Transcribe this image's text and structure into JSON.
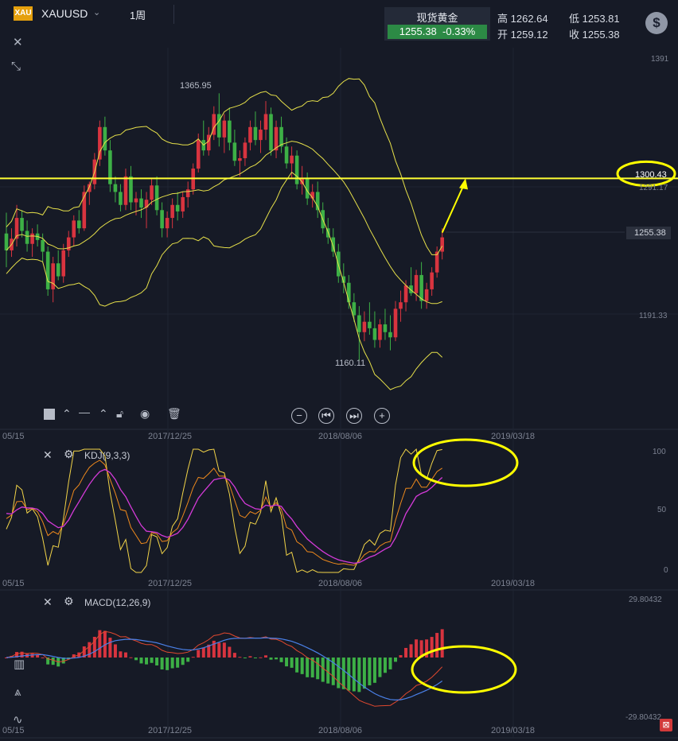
{
  "header": {
    "logo_text": "XAU",
    "symbol": "XAUUSD",
    "period": "1周",
    "quote_name": "现货黄金",
    "quote_price": "1255.38",
    "quote_change": "-0.33%",
    "high_label": "高",
    "high_value": "1262.64",
    "low_label": "低",
    "low_value": "1253.81",
    "open_label": "开",
    "open_value": "1259.12",
    "close_label": "收",
    "close_value": "1255.38",
    "currency_icon": "$"
  },
  "price_axis": {
    "top": "1391",
    "hline_label": "1300.43",
    "level_1291": "1291.17",
    "current": "1255.38",
    "level_1191": "1191.33"
  },
  "annotations": {
    "high_mark": "1365.95",
    "low_mark": "1160.11"
  },
  "dates": [
    "05/15",
    "2017/12/25",
    "2018/08/06",
    "2019/03/18"
  ],
  "kdj": {
    "label": "KDJ(9,3,3)",
    "axis_top": "100",
    "axis_mid": "50",
    "axis_bottom": "0"
  },
  "macd": {
    "label": "MACD(12,26,9)",
    "axis_top": "29.80432",
    "axis_bottom": "-29.80432"
  },
  "colors": {
    "background": "#161a26",
    "up": "#d8343f",
    "down": "#3db046",
    "bollinger": "#e6e04a",
    "hline": "#ffff33",
    "k_line": "#f2d448",
    "d_line": "#f08a1c",
    "j_line": "#d43ad8",
    "macd_fast": "#e0482f",
    "macd_slow": "#4a80e8",
    "highlight": "#ffff00"
  },
  "chart_data": {
    "type": "candlestick",
    "highlight_level": 1300.43,
    "y_range": [
      1150,
      1395
    ],
    "candles": [
      [
        1258,
        1274,
        1232,
        1245
      ],
      [
        1245,
        1262,
        1240,
        1254
      ],
      [
        1254,
        1280,
        1248,
        1270
      ],
      [
        1270,
        1276,
        1255,
        1260
      ],
      [
        1260,
        1268,
        1244,
        1250
      ],
      [
        1250,
        1262,
        1240,
        1258
      ],
      [
        1258,
        1265,
        1248,
        1253
      ],
      [
        1253,
        1258,
        1236,
        1244
      ],
      [
        1244,
        1248,
        1210,
        1215
      ],
      [
        1215,
        1240,
        1205,
        1235
      ],
      [
        1235,
        1245,
        1222,
        1225
      ],
      [
        1225,
        1250,
        1220,
        1245
      ],
      [
        1245,
        1260,
        1240,
        1255
      ],
      [
        1255,
        1272,
        1248,
        1268
      ],
      [
        1268,
        1276,
        1258,
        1262
      ],
      [
        1262,
        1295,
        1260,
        1290
      ],
      [
        1290,
        1298,
        1280,
        1296
      ],
      [
        1296,
        1320,
        1292,
        1315
      ],
      [
        1315,
        1345,
        1310,
        1340
      ],
      [
        1340,
        1348,
        1318,
        1322
      ],
      [
        1322,
        1330,
        1290,
        1296
      ],
      [
        1296,
        1302,
        1282,
        1290
      ],
      [
        1290,
        1296,
        1275,
        1280
      ],
      [
        1280,
        1308,
        1276,
        1302
      ],
      [
        1302,
        1310,
        1276,
        1282
      ],
      [
        1282,
        1290,
        1272,
        1285
      ],
      [
        1285,
        1292,
        1270,
        1278
      ],
      [
        1278,
        1290,
        1262,
        1284
      ],
      [
        1284,
        1300,
        1280,
        1295
      ],
      [
        1295,
        1302,
        1272,
        1276
      ],
      [
        1276,
        1282,
        1255,
        1262
      ],
      [
        1262,
        1275,
        1255,
        1270
      ],
      [
        1270,
        1285,
        1262,
        1280
      ],
      [
        1280,
        1290,
        1268,
        1275
      ],
      [
        1275,
        1290,
        1270,
        1286
      ],
      [
        1286,
        1298,
        1278,
        1292
      ],
      [
        1292,
        1312,
        1288,
        1308
      ],
      [
        1308,
        1335,
        1305,
        1330
      ],
      [
        1330,
        1345,
        1318,
        1322
      ],
      [
        1322,
        1340,
        1318,
        1334
      ],
      [
        1334,
        1356,
        1330,
        1350
      ],
      [
        1350,
        1366,
        1325,
        1332
      ],
      [
        1332,
        1350,
        1320,
        1345
      ],
      [
        1345,
        1355,
        1322,
        1328
      ],
      [
        1328,
        1338,
        1310,
        1314
      ],
      [
        1314,
        1322,
        1302,
        1316
      ],
      [
        1316,
        1332,
        1310,
        1328
      ],
      [
        1328,
        1345,
        1322,
        1340
      ],
      [
        1340,
        1352,
        1326,
        1330
      ],
      [
        1330,
        1345,
        1320,
        1338
      ],
      [
        1338,
        1360,
        1330,
        1350
      ],
      [
        1350,
        1355,
        1318,
        1322
      ],
      [
        1322,
        1345,
        1316,
        1340
      ],
      [
        1340,
        1348,
        1320,
        1325
      ],
      [
        1325,
        1332,
        1308,
        1312
      ],
      [
        1312,
        1325,
        1300,
        1318
      ],
      [
        1318,
        1322,
        1292,
        1296
      ],
      [
        1296,
        1310,
        1288,
        1300
      ],
      [
        1300,
        1305,
        1280,
        1285
      ],
      [
        1285,
        1296,
        1278,
        1290
      ],
      [
        1290,
        1298,
        1270,
        1276
      ],
      [
        1276,
        1282,
        1258,
        1262
      ],
      [
        1262,
        1270,
        1250,
        1255
      ],
      [
        1255,
        1262,
        1240,
        1244
      ],
      [
        1244,
        1250,
        1220,
        1225
      ],
      [
        1225,
        1235,
        1212,
        1220
      ],
      [
        1220,
        1226,
        1200,
        1205
      ],
      [
        1205,
        1212,
        1190,
        1195
      ],
      [
        1195,
        1202,
        1160,
        1182
      ],
      [
        1182,
        1198,
        1175,
        1190
      ],
      [
        1190,
        1205,
        1180,
        1185
      ],
      [
        1185,
        1198,
        1170,
        1176
      ],
      [
        1176,
        1192,
        1170,
        1188
      ],
      [
        1188,
        1200,
        1176,
        1182
      ],
      [
        1182,
        1195,
        1168,
        1178
      ],
      [
        1178,
        1206,
        1175,
        1200
      ],
      [
        1200,
        1214,
        1190,
        1205
      ],
      [
        1205,
        1222,
        1198,
        1218
      ],
      [
        1218,
        1232,
        1210,
        1212
      ],
      [
        1212,
        1230,
        1206,
        1226
      ],
      [
        1226,
        1236,
        1200,
        1206
      ],
      [
        1206,
        1220,
        1200,
        1215
      ],
      [
        1215,
        1232,
        1210,
        1228
      ],
      [
        1228,
        1248,
        1224,
        1244
      ],
      [
        1244,
        1262,
        1238,
        1255
      ]
    ]
  }
}
